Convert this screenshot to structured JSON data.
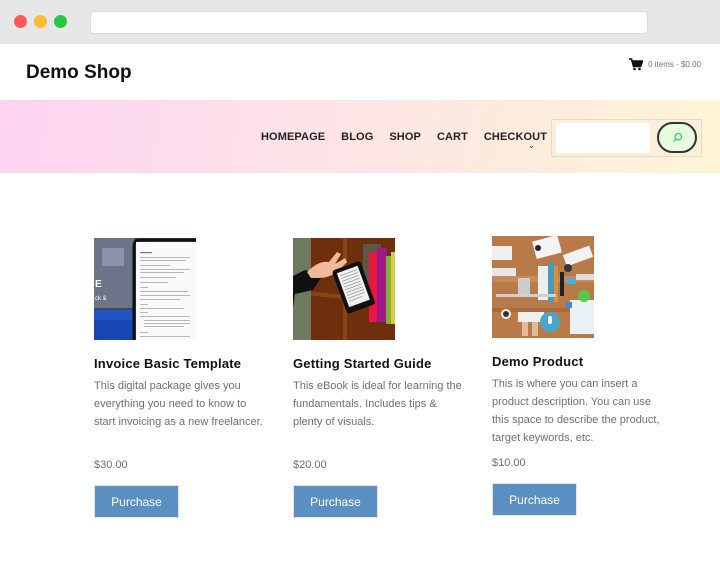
{
  "browser": {
    "url": ""
  },
  "header": {
    "site_title": "Demo Shop",
    "cart_summary": "0 items - $0.00",
    "cart_icon": "shopping-cart-icon"
  },
  "nav": {
    "items": [
      {
        "label": "HOMEPAGE"
      },
      {
        "label": "BLOG"
      },
      {
        "label": "SHOP"
      },
      {
        "label": "CART"
      },
      {
        "label": "CHECKOUT"
      }
    ],
    "dropdown_icon": "chevron-down-icon",
    "search": {
      "value": "",
      "placeholder": "",
      "button_icon": "search-icon"
    }
  },
  "products": [
    {
      "name": "Invoice Basic Template",
      "description": "This digital package gives you everything you need to know to start invoicing as a new freelancer.",
      "price": "$30.00",
      "button": "Purchase",
      "image": "invoice-document-image"
    },
    {
      "name": "Getting Started Guide",
      "description": "This eBook is ideal for learning the fundamentals. Includes tips & plenty of visuals.",
      "price": "$20.00",
      "button": "Purchase",
      "image": "ebook-reader-bookshelf-image"
    },
    {
      "name": "Demo Product",
      "description": "This is where you can insert a product description. You can use this space to describe the product, target keywords, etc.",
      "price": "$10.00",
      "button": "Purchase",
      "image": "team-desk-overhead-image"
    }
  ],
  "colors": {
    "button_bg": "#5b8fc2",
    "search_button_bg": "#e6fbe0",
    "nav_gradient_start": "#fdd3f1",
    "nav_gradient_end": "#fdf5d6"
  }
}
